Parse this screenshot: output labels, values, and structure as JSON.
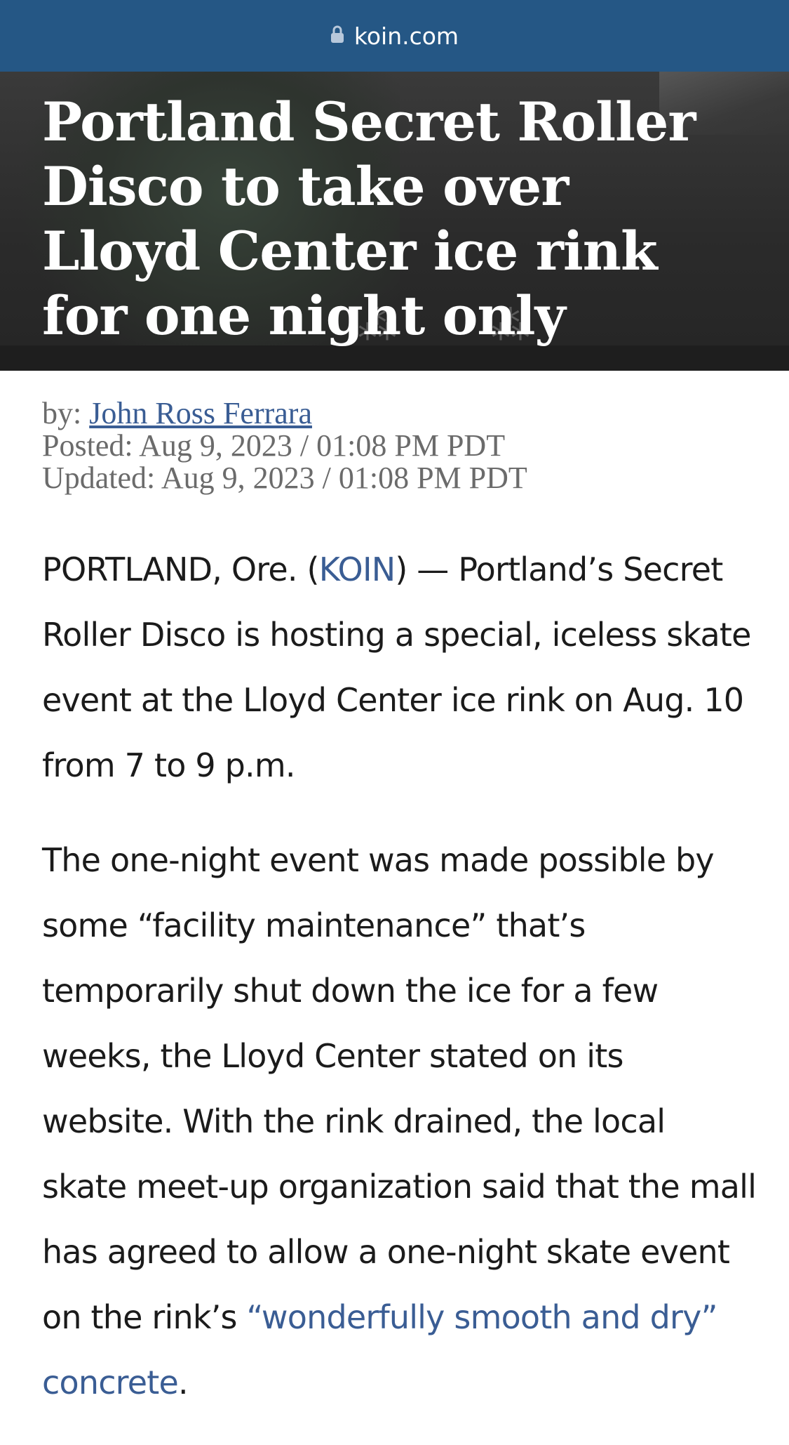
{
  "browser": {
    "url": "koin.com",
    "icon": "lock-icon"
  },
  "article": {
    "headline": "Portland Secret Roller Disco to take over Lloyd Center ice rink for one night only",
    "byline_prefix": "by: ",
    "author": "John Ross Ferrara",
    "posted": "Posted: Aug 9, 2023 / 01:08 PM PDT",
    "updated": "Updated: Aug 9, 2023 / 01:08 PM PDT",
    "p1": {
      "lead": "PORTLAND, Ore. (",
      "source_link": "KOIN",
      "rest": ") — Portland’s Secret Roller Disco is hosting a special, iceless skate event at the Lloyd Center ice rink on Aug. 10 from 7 to 9 p.m."
    },
    "p2": {
      "text": "The one-night event was made possible by some “facility maintenance” that’s temporarily shut down the ice for a few weeks, the Lloyd Center stated on its website. With the rink drained, the local skate meet-up organization said that the mall has agreed to allow a one-night skate event on the rink’s ",
      "quote_link": "“wonderfully smooth and dry” concrete",
      "end": "."
    }
  },
  "colors": {
    "url_bar": "#255785",
    "link": "#3a5d94",
    "meta_text": "#6b6b6b",
    "body_text": "#1b1b1b"
  }
}
